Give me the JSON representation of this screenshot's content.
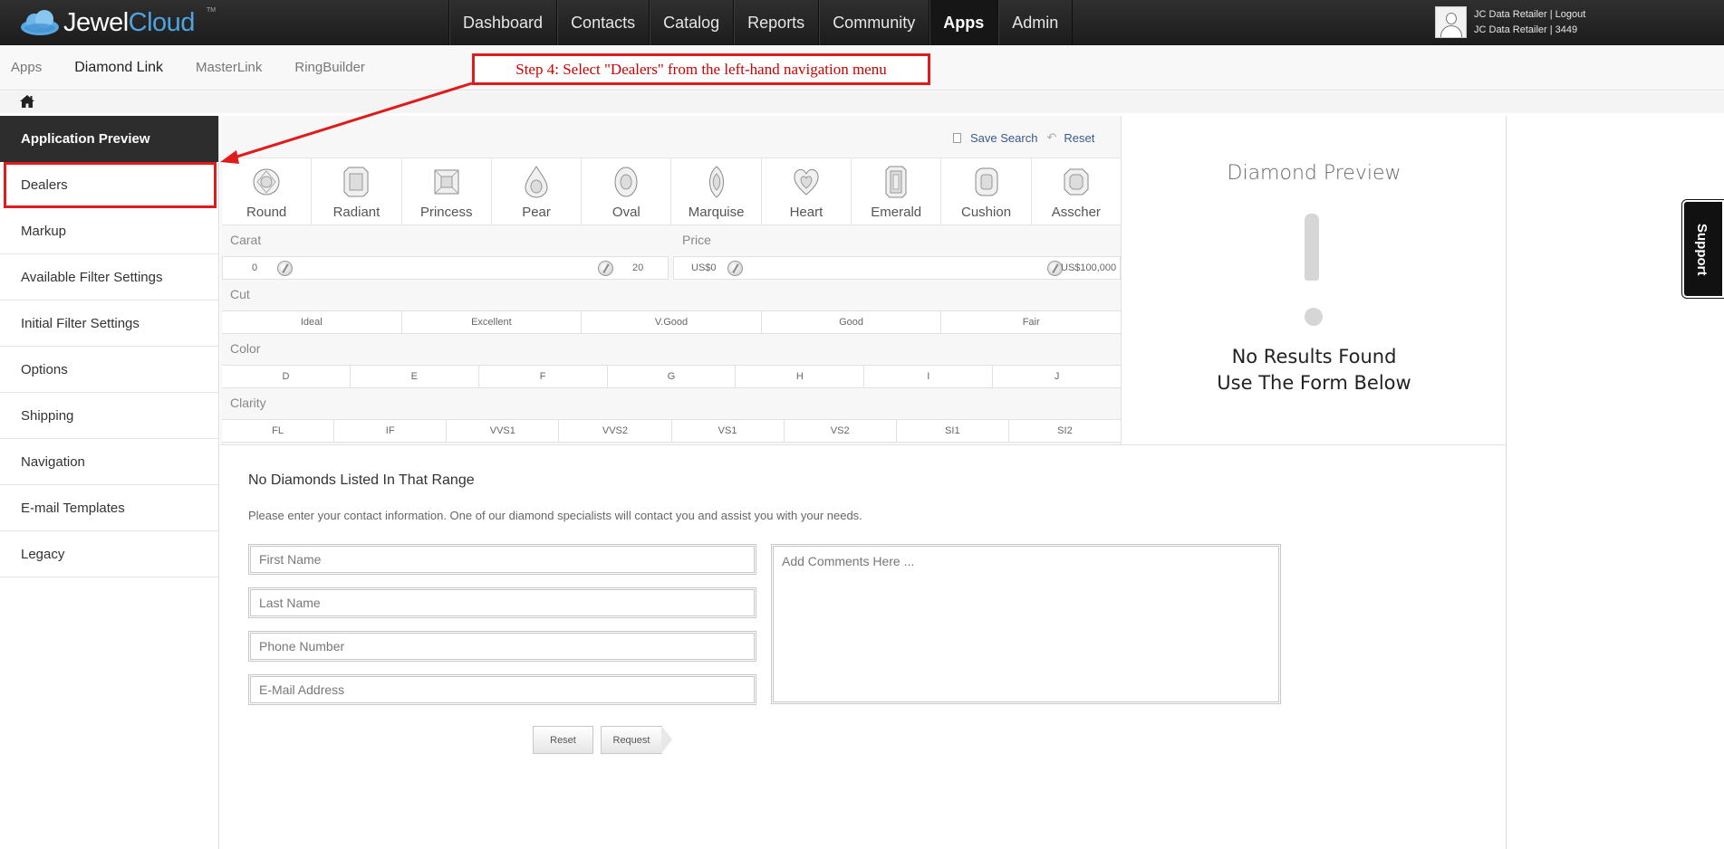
{
  "app": {
    "logo_part1": "Jewel",
    "logo_part2": "Cloud",
    "logo_tm": "TM"
  },
  "topnav": {
    "items": [
      {
        "label": "Dashboard"
      },
      {
        "label": "Contacts"
      },
      {
        "label": "Catalog"
      },
      {
        "label": "Reports"
      },
      {
        "label": "Community"
      },
      {
        "label": "Apps",
        "active": true
      },
      {
        "label": "Admin"
      }
    ]
  },
  "user": {
    "line1": "JC Data Retailer | Logout",
    "line2": "JC Data Retailer | 3449"
  },
  "subnav": {
    "items": [
      {
        "label": "Apps"
      },
      {
        "label": "Diamond Link",
        "active": true
      },
      {
        "label": "MasterLink"
      },
      {
        "label": "RingBuilder"
      }
    ]
  },
  "callout": {
    "text": "Step 4: Select \"Dealers\" from the left-hand navigation menu",
    "color": "#e01b1b"
  },
  "sidebar": {
    "header": "Application Preview",
    "items": [
      {
        "label": "Dealers",
        "highlighted": true
      },
      {
        "label": "Markup"
      },
      {
        "label": "Available Filter Settings"
      },
      {
        "label": "Initial Filter Settings"
      },
      {
        "label": "Options"
      },
      {
        "label": "Shipping"
      },
      {
        "label": "Navigation"
      },
      {
        "label": "E-mail Templates"
      },
      {
        "label": "Legacy"
      }
    ]
  },
  "search_actions": {
    "save": "Save Search",
    "reset": "Reset"
  },
  "shapes": [
    "Round",
    "Radiant",
    "Princess",
    "Pear",
    "Oval",
    "Marquise",
    "Heart",
    "Emerald",
    "Cushion",
    "Asscher"
  ],
  "carat": {
    "label": "Carat",
    "min": "0",
    "max": "20"
  },
  "price": {
    "label": "Price",
    "min": "US$0",
    "max": "US$100,000"
  },
  "cut": {
    "label": "Cut",
    "options": [
      "Ideal",
      "Excellent",
      "V.Good",
      "Good",
      "Fair"
    ]
  },
  "color": {
    "label": "Color",
    "options": [
      "D",
      "E",
      "F",
      "G",
      "H",
      "I",
      "J"
    ]
  },
  "clarity": {
    "label": "Clarity",
    "options": [
      "FL",
      "IF",
      "VVS1",
      "VVS2",
      "VS1",
      "VS2",
      "SI1",
      "SI2"
    ]
  },
  "preview": {
    "title": "Diamond Preview",
    "line1": "No Results Found",
    "line2": "Use The Form Below"
  },
  "contact_form": {
    "title": "No Diamonds Listed In That Range",
    "description": "Please enter your contact information. One of our diamond specialists will contact you and assist you with your needs.",
    "first_name_placeholder": "First Name",
    "last_name_placeholder": "Last Name",
    "phone_placeholder": "Phone Number",
    "email_placeholder": "E-Mail Address",
    "comments_placeholder": "Add Comments Here ...",
    "reset_label": "Reset",
    "request_label": "Request"
  },
  "support": {
    "label": "Support"
  }
}
